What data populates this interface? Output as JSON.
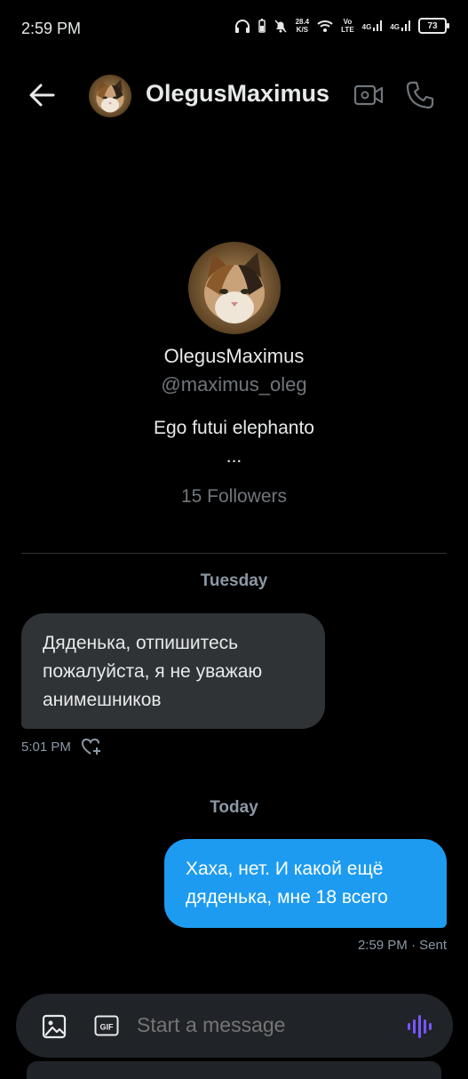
{
  "status_bar": {
    "time": "2:59 PM",
    "speed_value": "28.4",
    "speed_unit": "K/S",
    "volte_top": "Vo",
    "volte_bottom": "LTE",
    "net1": "4G",
    "net2": "4G",
    "battery": "73"
  },
  "header": {
    "title": "OlegusMaximus",
    "back_icon": "arrow-left-icon",
    "video_icon": "video-camera-icon",
    "phone_icon": "phone-icon"
  },
  "profile": {
    "name": "OlegusMaximus",
    "handle": "@maximus_oleg",
    "bio": "Ego futui elephanto",
    "bio_more": "...",
    "followers": "15 Followers"
  },
  "conversation": {
    "day1": "Tuesday",
    "incoming_text": "Дяденька, отпишитесь пожалуйста, я не уважаю анимешников",
    "incoming_time": "5:01 PM",
    "day2": "Today",
    "outgoing_text": "Хаха, нет. И какой ещё дяденька, мне 18 всего",
    "outgoing_meta": "2:59 PM · Sent"
  },
  "composer": {
    "placeholder": "Start a message",
    "gif_label": "GIF"
  },
  "colors": {
    "background": "#000000",
    "accent": "#1d9bf0",
    "incoming_bubble": "#2f3336",
    "muted": "#71767b",
    "voice_icon": "#7856ff"
  }
}
